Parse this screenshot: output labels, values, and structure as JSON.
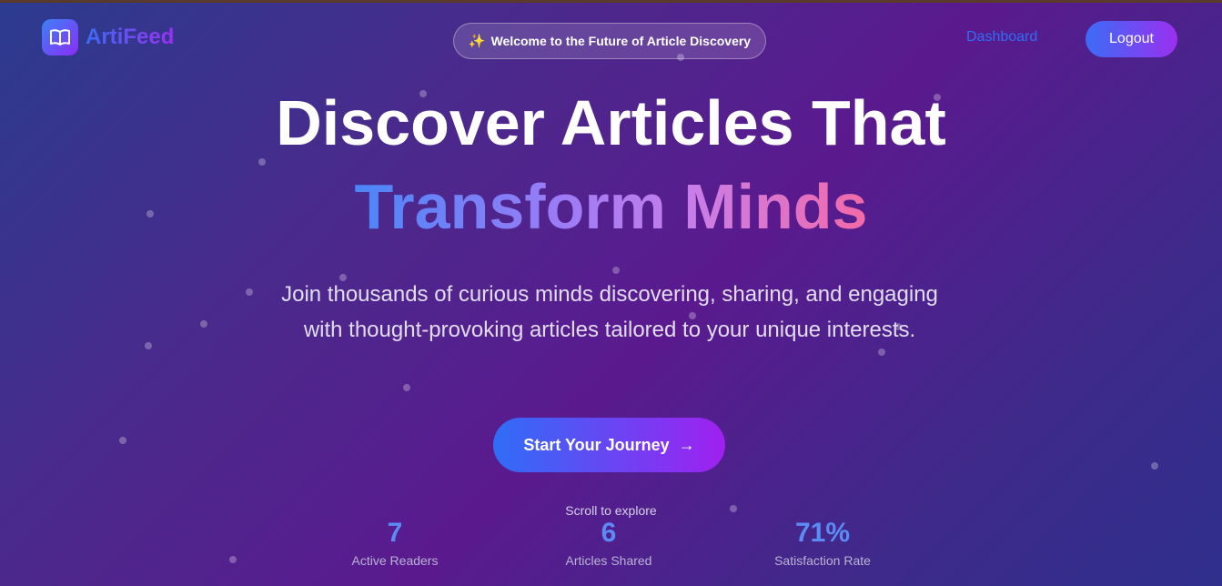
{
  "header": {
    "brand": "ArtiFeed",
    "welcome": "Welcome to the Future of Article Discovery",
    "nav_dashboard": "Dashboard",
    "logout": "Logout"
  },
  "hero": {
    "title_line1": "Discover Articles That",
    "title_line2": "Transform Minds",
    "subtitle": "Join thousands of curious minds discovering, sharing, and engaging with thought-provoking articles tailored to your unique interests.",
    "cta": "Start Your Journey",
    "scroll_hint": "Scroll to explore"
  },
  "stats": [
    {
      "value": "7",
      "label": "Active Readers"
    },
    {
      "value": "6",
      "label": "Articles Shared"
    },
    {
      "value": "71%",
      "label": "Satisfaction Rate"
    }
  ],
  "icons": {
    "logo": "open-book-icon",
    "welcome": "sparkles-icon",
    "cta": "arrow-right-icon"
  }
}
